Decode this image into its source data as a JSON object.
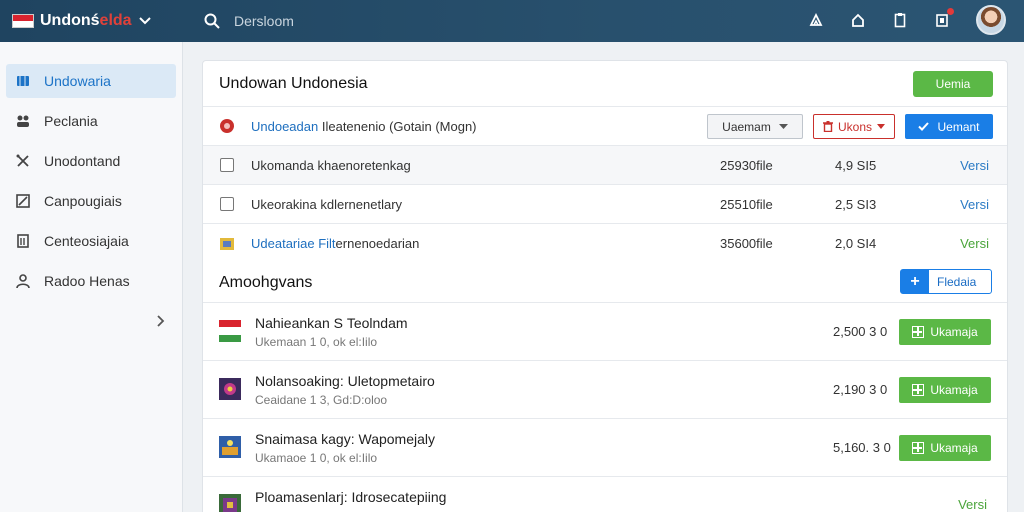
{
  "header": {
    "brand_prefix": "Undonś",
    "brand_accent": "elda",
    "search_placeholder": "Dersloom",
    "icons": [
      "bell-icon",
      "home-icon",
      "clipboard-icon",
      "flag-icon"
    ]
  },
  "sidebar": {
    "items": [
      {
        "label": "Undowaria",
        "icon": "map-icon",
        "active": true
      },
      {
        "label": "Peclania",
        "icon": "people-icon",
        "active": false
      },
      {
        "label": "Unodontand",
        "icon": "tools-icon",
        "active": false
      },
      {
        "label": "Canpougiais",
        "icon": "chart-icon",
        "active": false
      },
      {
        "label": "Centeosiajaia",
        "icon": "document-icon",
        "active": false
      },
      {
        "label": "Radoo Henas",
        "icon": "user-icon",
        "active": false
      }
    ]
  },
  "main": {
    "title": "Undowan Undonesia",
    "top_button": "Uemia",
    "filter_row": {
      "link": "Undoeadan",
      "text": "Ileatenenio (Gotain (Mogn)",
      "dropdown": "Uaemam",
      "red_button": "Ukons",
      "blue_button": "Uemant"
    },
    "file_rows": [
      {
        "name": "Ukomanda khaenoretenkag",
        "size": "25930file",
        "version": "4,9 ЅІ5",
        "action": "Versi"
      },
      {
        "name": "Ukeorakina kdlernenetlary",
        "size": "25510file",
        "version": "2,5 ЅІ3",
        "action": "Versi"
      },
      {
        "name_link": "Udeatariae Filt",
        "name_rest": "ernenoedarian",
        "size": "35600file",
        "version": "2,0 ЅІ4",
        "action": "Versi"
      }
    ],
    "section": {
      "title": "Amoohgvans",
      "button": "Fledaia"
    },
    "products": [
      {
        "name": "Nahieankan Ѕ Teolndam",
        "meta": "Ukemaan 1 0, ok el:Iilo",
        "price": "2,500 3 0",
        "button": "Ukamaja"
      },
      {
        "name": "Nolansoaking: Uletopmetairo",
        "meta": "Ceaidane 1 3, Gd:D:oloo",
        "price": "2,190 3 0",
        "button": "Ukamaja"
      },
      {
        "name": "Snaimasa kagy: Wapomejaly",
        "meta": "Ukamaoe 1 0, ok el:Iilo",
        "price": "5,160. 3 0",
        "button": "Ukamaja"
      },
      {
        "name": "Ploamasenlarj: Idrosecatepiing",
        "meta": "",
        "price": "",
        "status": "Versi"
      }
    ]
  },
  "colors": {
    "topbar": "#28506d",
    "accent_blue": "#1a7ee6",
    "accent_green": "#5bb846",
    "accent_red": "#c9302c"
  }
}
